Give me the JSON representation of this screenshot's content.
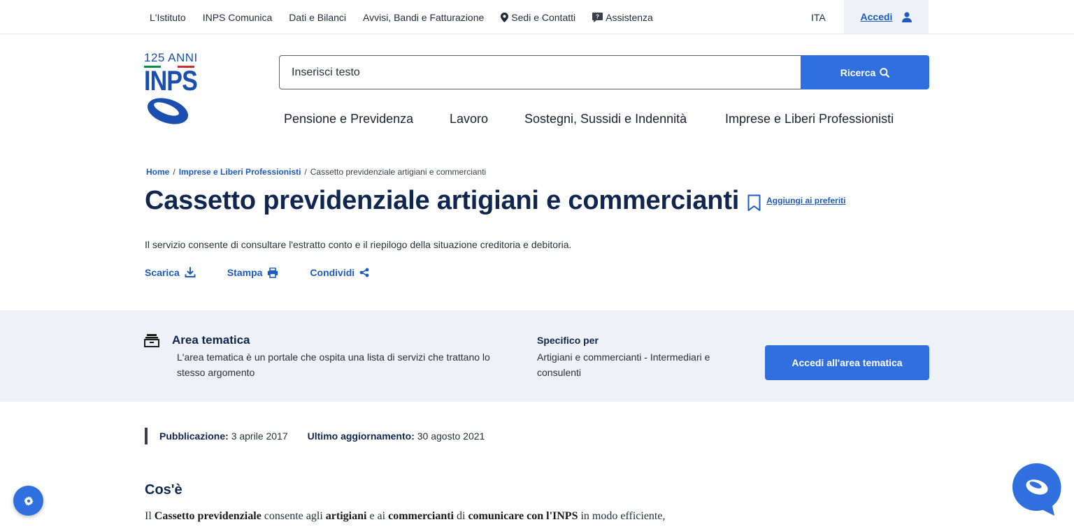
{
  "topbar": {
    "items": [
      {
        "label": "L'Istituto"
      },
      {
        "label": "INPS Comunica"
      },
      {
        "label": "Dati e Bilanci"
      },
      {
        "label": "Avvisi, Bandi e Fatturazione"
      },
      {
        "label": "Sedi e Contatti",
        "icon": "map-pin-icon"
      },
      {
        "label": "Assistenza",
        "icon": "help-chat-icon"
      }
    ],
    "language": "ITA",
    "login_label": "Accedi",
    "login_icon": "user-icon"
  },
  "logo": {
    "anni": "125 ANNI",
    "brand": "INPS",
    "flag_colors": [
      "#009246",
      "#ffffff",
      "#ce2b37"
    ]
  },
  "search": {
    "placeholder": "Inserisci testo",
    "button_label": "Ricerca",
    "button_icon": "search-icon"
  },
  "main_nav": [
    {
      "label": "Pensione e Previdenza"
    },
    {
      "label": "Lavoro"
    },
    {
      "label": "Sostegni, Sussidi e Indennità"
    },
    {
      "label": "Imprese e Liberi Professionisti"
    }
  ],
  "breadcrumb": {
    "home": "Home",
    "section": "Imprese e Liberi Professionisti",
    "current": "Cassetto previdenziale artigiani e commercianti",
    "separator": "/"
  },
  "page": {
    "title": "Cassetto previdenziale artigiani e commercianti",
    "favorite_label": "Aggiungi ai preferiti",
    "description": "Il servizio consente di consultare l'estratto conto e il riepilogo della situazione creditoria e debitoria.",
    "actions": {
      "download": "Scarica",
      "print": "Stampa",
      "share": "Condividi"
    }
  },
  "area": {
    "title": "Area tematica",
    "description": "L'area tematica è un portale che ospita una lista di servizi che trattano lo stesso argomento",
    "specific_title": "Specifico per",
    "specific_value": "Artigiani e commercianti - Intermediari e consulenti",
    "button_label": "Accedi all'area tematica"
  },
  "meta": {
    "published_label": "Pubblicazione:",
    "published_value": "3 aprile 2017",
    "updated_label": "Ultimo aggiornamento:",
    "updated_value": "30 agosto 2021"
  },
  "section": {
    "title": "Cos'è",
    "intro_1": "Il ",
    "bold_1": "Cassetto previdenziale",
    "text_2": " consente agli ",
    "bold_2": "artigiani",
    "text_3": " e ai ",
    "bold_3": "commercianti",
    "text_4": " di ",
    "bold_4": "comunicare con l'INPS",
    "text_5": " in modo efficiente,"
  },
  "colors": {
    "primary": "#2f6fde",
    "link": "#1e5bbf",
    "heading": "#0f2650",
    "band": "#eef2f7"
  }
}
